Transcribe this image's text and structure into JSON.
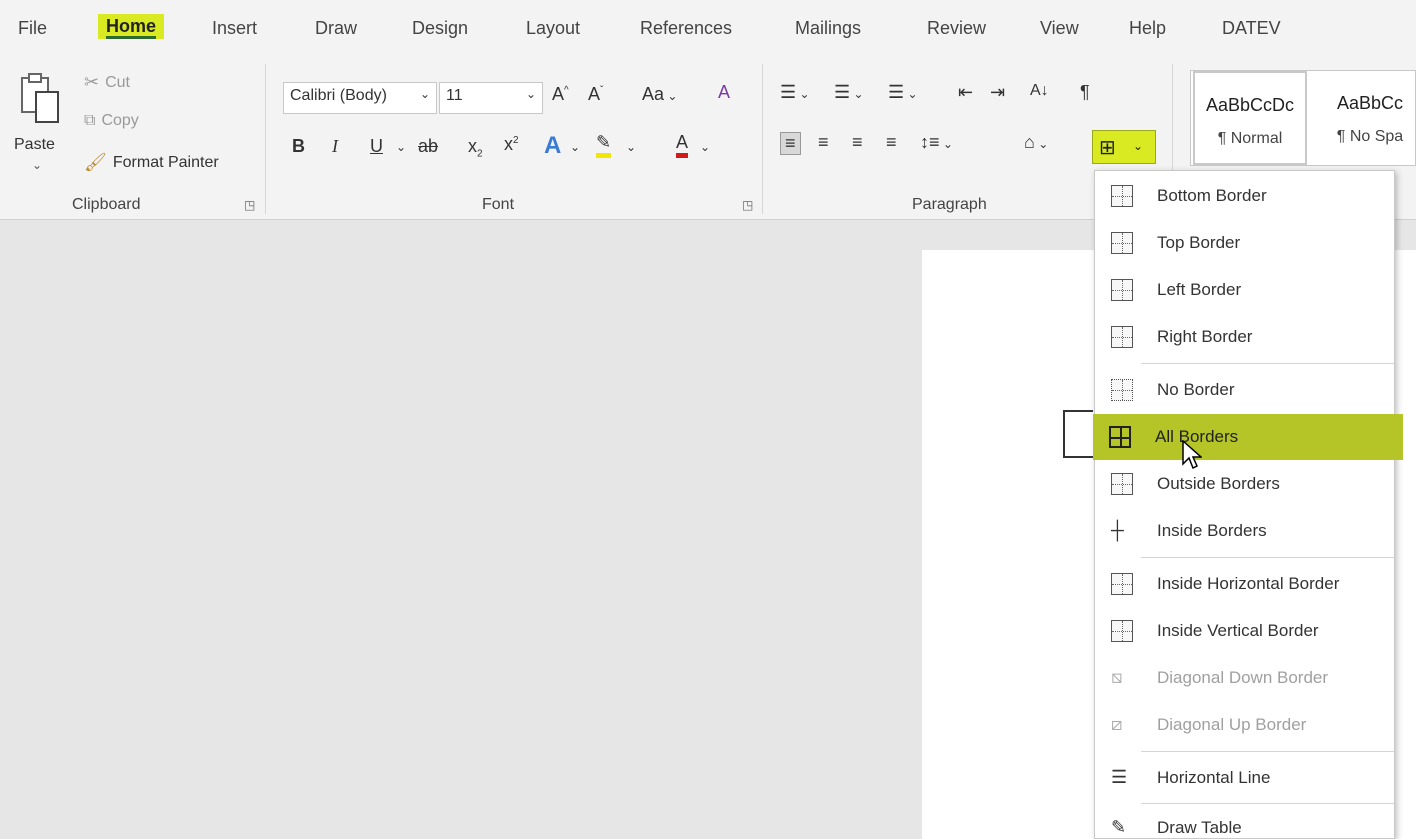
{
  "tabs": [
    "File",
    "Home",
    "Insert",
    "Draw",
    "Design",
    "Layout",
    "References",
    "Mailings",
    "Review",
    "View",
    "Help",
    "DATEV"
  ],
  "active_tab": "Home",
  "accent_color": "#d9ea23",
  "clipboard": {
    "paste_label": "Paste",
    "cut_label": "Cut",
    "copy_label": "Copy",
    "format_painter_label": "Format Painter",
    "group_label": "Clipboard"
  },
  "font": {
    "font_name": "Calibri (Body)",
    "font_size": "11",
    "change_case_label": "Aa",
    "group_label": "Font"
  },
  "paragraph": {
    "group_label": "Paragraph"
  },
  "styles": {
    "items": [
      {
        "sample": "AaBbCcDc",
        "name": "¶ Normal"
      },
      {
        "sample": "AaBbCc",
        "name": "¶ No Spa"
      }
    ]
  },
  "border_menu": {
    "items": [
      {
        "label": "Bottom Border",
        "mnemonic": "B",
        "rest": "ottom Border"
      },
      {
        "label": "Top Border"
      },
      {
        "label": "Left Border"
      },
      {
        "label": "Right Border"
      },
      {
        "label": "No Border"
      },
      {
        "label": "All Borders"
      },
      {
        "label": "Outside Borders"
      },
      {
        "label": "Inside Borders"
      },
      {
        "label": "Inside Horizontal Border"
      },
      {
        "label": "Inside Vertical Border"
      },
      {
        "label": "Diagonal Down Border"
      },
      {
        "label": "Diagonal Up Border"
      },
      {
        "label": "Horizontal Line"
      },
      {
        "label": "Draw Table"
      }
    ],
    "hovered": "All Borders"
  }
}
